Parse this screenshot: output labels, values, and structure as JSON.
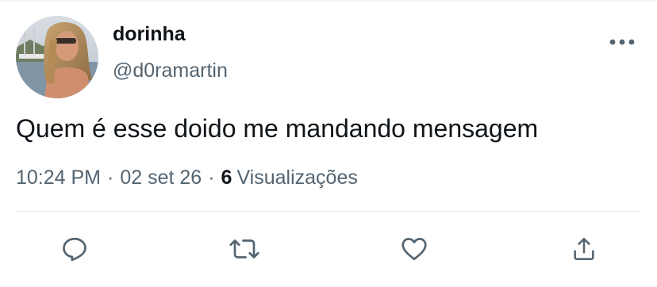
{
  "tweet": {
    "display_name": "dorinha",
    "handle": "@d0ramartin",
    "text": "Quem é esse doido me mandando mensagem",
    "time": "10:24 PM",
    "date": "02 set 26",
    "separator": "·",
    "views_count": "6",
    "views_label": "Visualizações"
  },
  "icons": {
    "more": "more-horizontal-icon",
    "reply": "reply-icon",
    "retweet": "retweet-icon",
    "like": "heart-icon",
    "share": "share-icon"
  },
  "colors": {
    "primary_text": "#0f1419",
    "secondary_text": "#536471",
    "icon": "#536471",
    "divider": "#e3e7ea"
  }
}
